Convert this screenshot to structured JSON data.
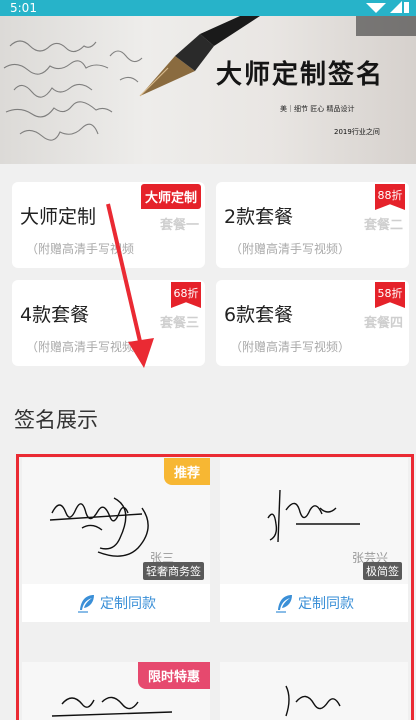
{
  "status_bar": {
    "time": "5:01"
  },
  "banner": {
    "title": "大师定制签名",
    "subtitle": "美｜细节 匠心 精品设计",
    "year": "2019行业之间"
  },
  "packages": [
    {
      "name": "大师定制",
      "sub": "（附赠高清手写视频",
      "pkg": "套餐一",
      "badge": "大师定制"
    },
    {
      "name": "2款套餐",
      "sub": "（附赠高清手写视频）",
      "pkg": "套餐二",
      "badge": "88折"
    },
    {
      "name": "4款套餐",
      "sub": "（附赠高清手写视频",
      "pkg": "套餐三",
      "badge": "68折"
    },
    {
      "name": "6款套餐",
      "sub": "（附赠高清手写视频）",
      "pkg": "套餐四",
      "badge": "58折"
    }
  ],
  "section_title": "签名展示",
  "showcase": [
    {
      "ribbon": "推荐",
      "tag": "轻奢商务签",
      "button": "定制同款",
      "ribbon_color": "#f7b733"
    },
    {
      "ribbon": "",
      "tag": "极简签",
      "button": "定制同款",
      "ribbon_color": ""
    },
    {
      "ribbon": "限时特惠",
      "tag": "",
      "button": "",
      "ribbon_color": "#e6496e"
    },
    {
      "ribbon": "",
      "tag": "",
      "button": "",
      "ribbon_color": ""
    }
  ],
  "colors": {
    "status_bar": "#27b3c9",
    "badge_red": "#e5222a",
    "link_blue": "#3a8fd7",
    "annotation_red": "#ea2a33"
  }
}
